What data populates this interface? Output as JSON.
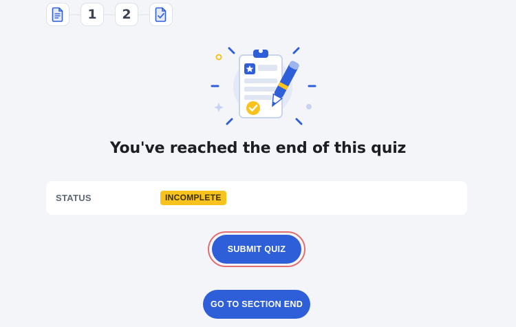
{
  "stepper": {
    "steps": [
      {
        "type": "document-icon"
      },
      {
        "label": "1"
      },
      {
        "label": "2"
      },
      {
        "type": "checklist-icon"
      }
    ]
  },
  "illustration": {
    "icon": "clipboard-checklist-with-pen",
    "colors": {
      "primary": "#2f5fd8",
      "light": "#e3e9f7",
      "accent": "#f8c31c"
    }
  },
  "main": {
    "title": "You've reached the end of this quiz"
  },
  "status": {
    "label": "STATUS",
    "value": "INCOMPLETE"
  },
  "actions": {
    "submit_label": "SUBMIT QUIZ",
    "section_end_label": "GO TO SECTION END"
  },
  "colors": {
    "primary_button": "#2f5fd8",
    "badge": "#f8c31c",
    "focus_ring": "#e36c70",
    "background": "#f4f5f8"
  }
}
